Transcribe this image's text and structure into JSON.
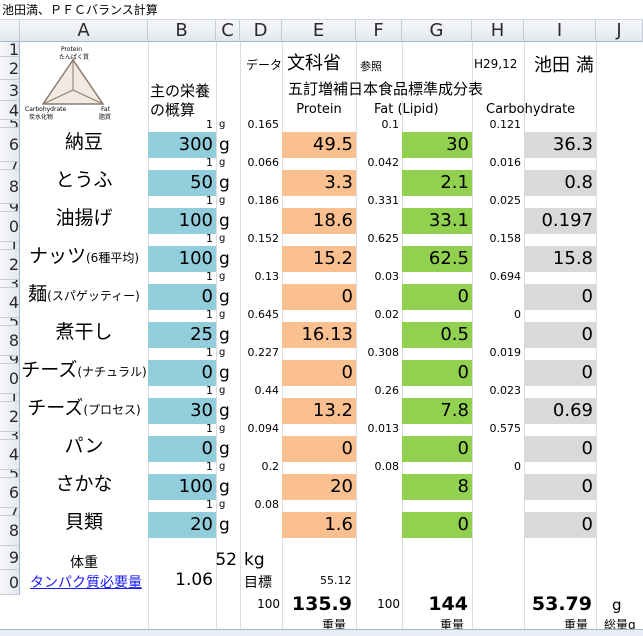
{
  "window": {
    "title": "池田満、ＰＦＣバランス計算"
  },
  "columns": [
    "A",
    "B",
    "C",
    "D",
    "E",
    "F",
    "G",
    "H",
    "I",
    "J"
  ],
  "row_numbers": [
    "1",
    "2",
    "3",
    "4",
    "5",
    "6",
    "7",
    "8",
    "9",
    "0",
    "1",
    "2",
    "3",
    "4",
    "5",
    "8",
    "9",
    "0",
    "1",
    "2",
    "3",
    "4",
    "5",
    "6",
    "7",
    "8",
    "9",
    "0"
  ],
  "header": {
    "data_label": "データ",
    "source": "文科省",
    "ref": "参照",
    "date": "H29,12",
    "author": "池田 満",
    "table_name": "五訂増補日本食品標準成分表",
    "nutrient_label_1": "主の栄養",
    "nutrient_label_2": "の概算",
    "protein": "Protein",
    "fat": "Fat (Lipid)",
    "carb": "Carbohydrate"
  },
  "logo": {
    "top": "Protein",
    "top_jp": "たんぱく質",
    "left": "Carbohydrate",
    "left_jp": "炭水化物",
    "right": "Fat",
    "right_jp": "脂質"
  },
  "foods": [
    {
      "name": "納豆",
      "unit": "1",
      "g": "g",
      "p_per": "0.165",
      "f_per": "0.1",
      "c_per": "0.121",
      "amount": "300",
      "p": "49.5",
      "f": "30",
      "c": "36.3"
    },
    {
      "name": "とうふ",
      "unit": "1",
      "g": "g",
      "p_per": "0.066",
      "f_per": "0.042",
      "c_per": "0.016",
      "amount": "50",
      "p": "3.3",
      "f": "2.1",
      "c": "0.8"
    },
    {
      "name": "油揚げ",
      "unit": "1",
      "g": "g",
      "p_per": "0.186",
      "f_per": "0.331",
      "c_per": "0.025",
      "amount": "100",
      "p": "18.6",
      "f": "33.1",
      "c": "0.197"
    },
    {
      "name": "ナッツ",
      "sub": "(6種平均)",
      "unit": "1",
      "g": "g",
      "p_per": "0.152",
      "f_per": "0.625",
      "c_per": "0.158",
      "amount": "100",
      "p": "15.2",
      "f": "62.5",
      "c": "15.8"
    },
    {
      "name": "麺",
      "sub": "(スパゲッティー)",
      "unit": "1",
      "g": "g",
      "p_per": "0.13",
      "f_per": "0.03",
      "c_per": "0.694",
      "amount": "0",
      "p": "0",
      "f": "0",
      "c": "0"
    },
    {
      "name": "煮干し",
      "unit": "1",
      "g": "g",
      "p_per": "0.645",
      "f_per": "0.02",
      "c_per": "0",
      "amount": "25",
      "p": "16.13",
      "f": "0.5",
      "c": "0"
    },
    {
      "name": "チーズ",
      "sub": "(ナチュラル)",
      "unit": "1",
      "g": "g",
      "p_per": "0.227",
      "f_per": "0.308",
      "c_per": "0.019",
      "amount": "0",
      "p": "0",
      "f": "0",
      "c": "0"
    },
    {
      "name": "チーズ",
      "sub": "(プロセス)",
      "unit": "1",
      "g": "g",
      "p_per": "0.44",
      "f_per": "0.26",
      "c_per": "0.023",
      "amount": "30",
      "p": "13.2",
      "f": "7.8",
      "c": "0.69"
    },
    {
      "name": "パン",
      "unit": "1",
      "g": "g",
      "p_per": "0.094",
      "f_per": "0.013",
      "c_per": "0.575",
      "amount": "0",
      "p": "0",
      "f": "0",
      "c": "0"
    },
    {
      "name": "さかな",
      "unit": "1",
      "g": "g",
      "p_per": "0.2",
      "f_per": "0.08",
      "c_per": "0",
      "amount": "100",
      "p": "20",
      "f": "8",
      "c": "0"
    },
    {
      "name": "貝類",
      "unit": "1",
      "g": "g",
      "p_per": "0.08",
      "f_per": "",
      "c_per": "",
      "amount": "20",
      "p": "1.6",
      "f": "0",
      "c": "0"
    }
  ],
  "footer": {
    "weight_label": "体重",
    "weight": "52",
    "weight_unit": "kg",
    "protein_need": "タンパク質必要量",
    "protein_factor": "1.06",
    "target_label": "目標",
    "target": "55.12",
    "pct_p": "100",
    "total_p": "135.9",
    "pct_f": "100",
    "total_f": "144",
    "total_c": "53.79",
    "g": "g",
    "weight_word": "重量",
    "total_weight": "総量g"
  },
  "colors": {
    "blue": "#92cddc",
    "orange": "#fac090",
    "green": "#92d050",
    "gray": "#d9d9d9"
  }
}
